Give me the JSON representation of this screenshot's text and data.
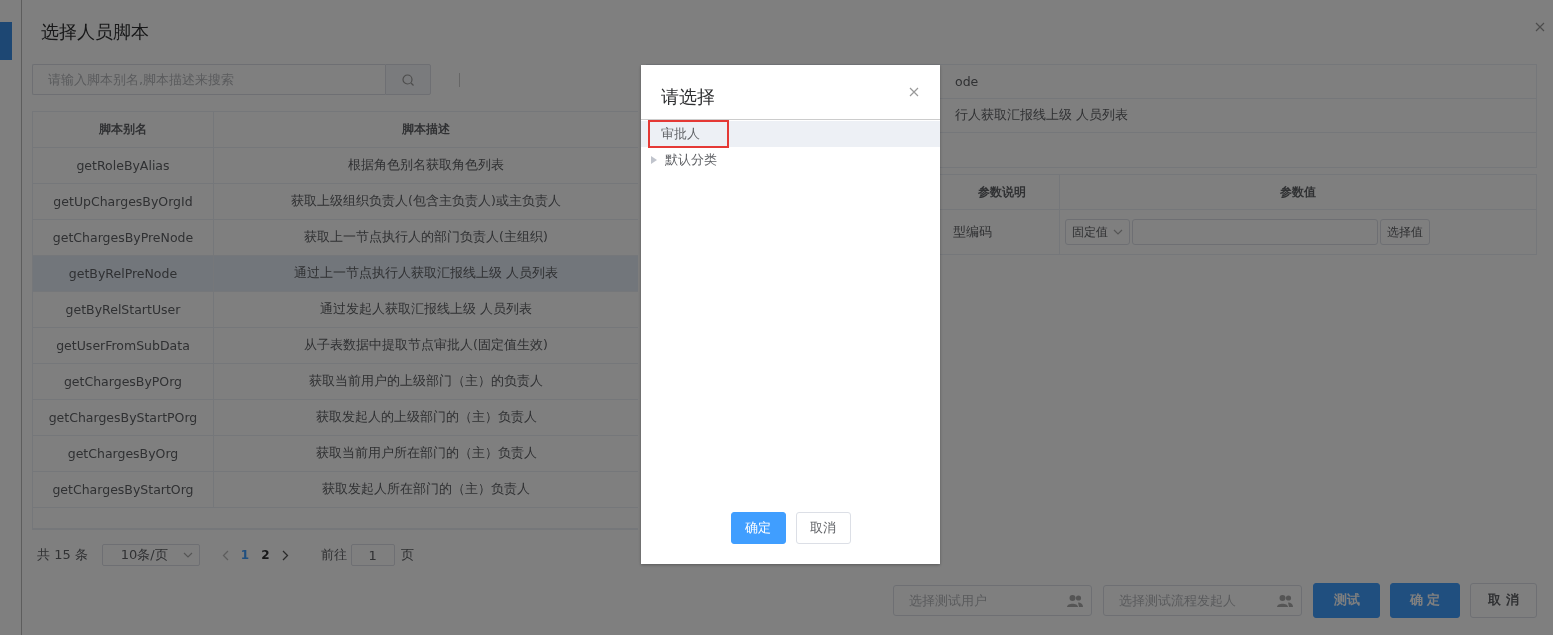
{
  "dialog": {
    "title": "选择人员脚本",
    "search": {
      "placeholder": "请输入脚本别名,脚本描述来搜索"
    },
    "table": {
      "columns": [
        "脚本别名",
        "脚本描述"
      ],
      "rows": [
        {
          "cells": [
            "getRoleByAlias",
            "根据角色别名获取角色列表"
          ],
          "selected": false
        },
        {
          "cells": [
            "getUpChargesByOrgId",
            "获取上级组织负责人(包含主负责人)或主负责人"
          ],
          "selected": false
        },
        {
          "cells": [
            "getChargesByPreNode",
            "获取上一节点执行人的部门负责人(主组织)"
          ],
          "selected": false
        },
        {
          "cells": [
            "getByRelPreNode",
            "通过上一节点执行人获取汇报线上级 人员列表"
          ],
          "selected": true
        },
        {
          "cells": [
            "getByRelStartUser",
            "通过发起人获取汇报线上级 人员列表"
          ],
          "selected": false
        },
        {
          "cells": [
            "getUserFromSubData",
            "从子表数据中提取节点审批人(固定值生效)"
          ],
          "selected": false
        },
        {
          "cells": [
            "getChargesByPOrg",
            "获取当前用户的上级部门（主）的负责人"
          ],
          "selected": false
        },
        {
          "cells": [
            "getChargesByStartPOrg",
            "获取发起人的上级部门的（主）负责人"
          ],
          "selected": false
        },
        {
          "cells": [
            "getChargesByOrg",
            "获取当前用户所在部门的（主）负责人"
          ],
          "selected": false
        },
        {
          "cells": [
            "getChargesByStartOrg",
            "获取发起人所在部门的（主）负责人"
          ],
          "selected": false
        }
      ]
    },
    "pagination": {
      "total": "共 15 条",
      "page_size": "10条/页",
      "pages": [
        {
          "label": "1",
          "selected": true
        },
        {
          "label": "2",
          "selected": false
        }
      ],
      "goto_label": "前往",
      "goto_value": "1",
      "goto_suffix": "页"
    },
    "detail": {
      "rows": [
        "ode",
        "行人获取汇报线上级 人员列表"
      ]
    },
    "params": {
      "columns": [
        "参数说明",
        "参数值"
      ],
      "rows": [
        {
          "description": "型编码",
          "mode": "固定值",
          "button": "选择值"
        }
      ]
    },
    "test_user": {
      "placeholder": "选择测试用户"
    },
    "test_starter": {
      "placeholder": "选择测试流程发起人"
    },
    "buttons": [
      {
        "label": "测试",
        "kind": "primary"
      },
      {
        "label": "确 定",
        "kind": "primary"
      },
      {
        "label": "取 消",
        "kind": "default"
      }
    ]
  },
  "picker": {
    "title": "请选择",
    "tree": [
      {
        "label": "审批人",
        "kind": "leaf",
        "selected": true,
        "marked": true
      },
      {
        "label": "默认分类",
        "kind": "branch",
        "selected": false,
        "marked": false
      }
    ],
    "buttons": [
      {
        "label": "确定",
        "kind": "primary"
      },
      {
        "label": "取消",
        "kind": "default"
      }
    ]
  }
}
